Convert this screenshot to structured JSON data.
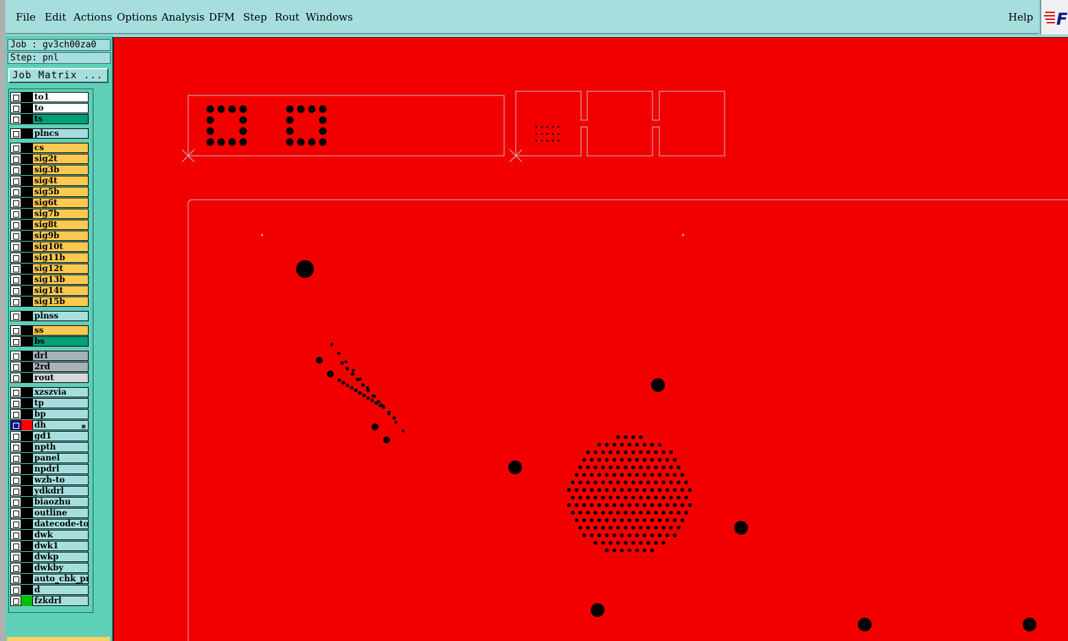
{
  "menu": {
    "items": [
      "File",
      "Edit",
      "Actions",
      "Options",
      "Analysis",
      "DFM",
      "Step",
      "Rout",
      "Windows"
    ],
    "help": "Help"
  },
  "logo": {
    "icon": "fast-logo-icon",
    "text": "F"
  },
  "panel": {
    "job_label": "Job : gv3ch00za0",
    "step_label": "Step: pnl",
    "job_matrix_button": "Job Matrix ..."
  },
  "layers": [
    {
      "name": "to1",
      "color": "#ffffff",
      "swatch": "#000000",
      "active": false
    },
    {
      "name": "to",
      "color": "#ffffff",
      "swatch": "#000000",
      "active": false
    },
    {
      "name": "ts",
      "color": "#00a078",
      "swatch": "#000000",
      "active": false
    },
    {
      "name": "plncs",
      "color": "#a6dede",
      "swatch": "#000000",
      "active": false
    },
    {
      "name": "cs",
      "color": "#ffc850",
      "swatch": "#000000",
      "active": false
    },
    {
      "name": "sig2t",
      "color": "#ffc850",
      "swatch": "#000000",
      "active": false
    },
    {
      "name": "sig3b",
      "color": "#ffc850",
      "swatch": "#000000",
      "active": false
    },
    {
      "name": "sig4t",
      "color": "#ffc850",
      "swatch": "#000000",
      "active": false
    },
    {
      "name": "sig5b",
      "color": "#ffc850",
      "swatch": "#000000",
      "active": false
    },
    {
      "name": "sig6t",
      "color": "#ffc850",
      "swatch": "#000000",
      "active": false
    },
    {
      "name": "sig7b",
      "color": "#ffc850",
      "swatch": "#000000",
      "active": false
    },
    {
      "name": "sig8t",
      "color": "#ffc850",
      "swatch": "#000000",
      "active": false
    },
    {
      "name": "sig9b",
      "color": "#ffc850",
      "swatch": "#000000",
      "active": false
    },
    {
      "name": "sig10t",
      "color": "#ffc850",
      "swatch": "#000000",
      "active": false
    },
    {
      "name": "sig11b",
      "color": "#ffc850",
      "swatch": "#000000",
      "active": false
    },
    {
      "name": "sig12t",
      "color": "#ffc850",
      "swatch": "#000000",
      "active": false
    },
    {
      "name": "sig13b",
      "color": "#ffc850",
      "swatch": "#000000",
      "active": false
    },
    {
      "name": "sig14t",
      "color": "#ffc850",
      "swatch": "#000000",
      "active": false
    },
    {
      "name": "sig15b",
      "color": "#ffc850",
      "swatch": "#000000",
      "active": false
    },
    {
      "name": "plnss",
      "color": "#a6dede",
      "swatch": "#000000",
      "active": false
    },
    {
      "name": "ss",
      "color": "#ffc850",
      "swatch": "#000000",
      "active": false
    },
    {
      "name": "bs",
      "color": "#00a078",
      "swatch": "#000000",
      "active": false
    },
    {
      "name": "drl",
      "color": "#a8b0b8",
      "swatch": "#000000",
      "active": false
    },
    {
      "name": "2rd",
      "color": "#a8b0b8",
      "swatch": "#000000",
      "active": false
    },
    {
      "name": "rout",
      "color": "#d8d8d8",
      "swatch": "#000000",
      "active": false
    },
    {
      "name": "xzszvia",
      "color": "#a6dede",
      "swatch": "#000000",
      "active": false
    },
    {
      "name": "tp",
      "color": "#a6dede",
      "swatch": "#000000",
      "active": false
    },
    {
      "name": "bp",
      "color": "#a6dede",
      "swatch": "#000000",
      "active": false
    },
    {
      "name": "dh",
      "color": "#a6dede",
      "swatch": "#ff0000",
      "active": true
    },
    {
      "name": "gd1",
      "color": "#a6dede",
      "swatch": "#000000",
      "active": false
    },
    {
      "name": "npth",
      "color": "#a6dede",
      "swatch": "#000000",
      "active": false
    },
    {
      "name": "panel",
      "color": "#a6dede",
      "swatch": "#000000",
      "active": false
    },
    {
      "name": "npdrl",
      "color": "#a6dede",
      "swatch": "#000000",
      "active": false
    },
    {
      "name": "wzh-to",
      "color": "#a6dede",
      "swatch": "#000000",
      "active": false
    },
    {
      "name": "ydkdrl",
      "color": "#a6dede",
      "swatch": "#000000",
      "active": false
    },
    {
      "name": "biaozhu",
      "color": "#a6dede",
      "swatch": "#000000",
      "active": false
    },
    {
      "name": "outline",
      "color": "#a6dede",
      "swatch": "#000000",
      "active": false
    },
    {
      "name": "datecode-to",
      "color": "#a6dede",
      "swatch": "#000000",
      "active": false
    },
    {
      "name": "dwk",
      "color": "#a6dede",
      "swatch": "#000000",
      "active": false
    },
    {
      "name": "dwk1",
      "color": "#a6dede",
      "swatch": "#000000",
      "active": false
    },
    {
      "name": "dwkp",
      "color": "#a6dede",
      "swatch": "#000000",
      "active": false
    },
    {
      "name": "dwkby",
      "color": "#a6dede",
      "swatch": "#000000",
      "active": false
    },
    {
      "name": "auto_chk_pnl",
      "color": "#a6dede",
      "swatch": "#000000",
      "active": false
    },
    {
      "name": "d",
      "color": "#a6dede",
      "swatch": "#000000",
      "active": false
    },
    {
      "name": "fzkdrl",
      "color": "#a6dede",
      "swatch": "#00c000",
      "active": false
    }
  ],
  "colors": {
    "canvas_bg": "#f20000",
    "feature": "#000000",
    "outline": "#c8c8c8",
    "marker": "#ffa000"
  }
}
